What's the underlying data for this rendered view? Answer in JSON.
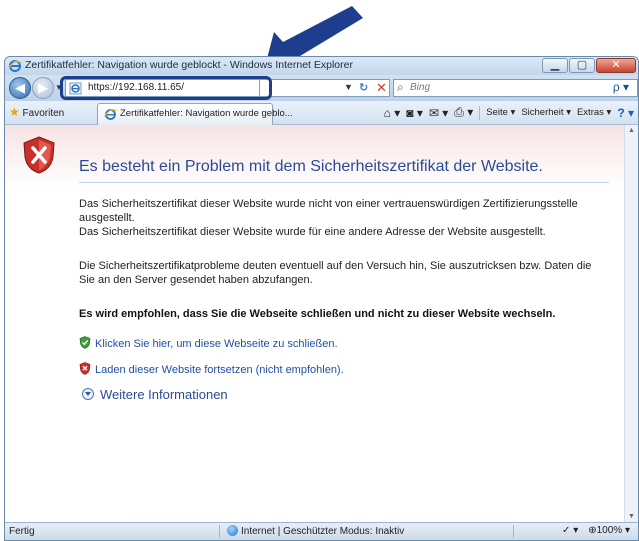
{
  "window": {
    "title": "Zertifikatfehler: Navigation wurde geblockt - Windows Internet Explorer",
    "minimize_symbol": "▁",
    "maximize_symbol": "▢",
    "close_symbol": "✕"
  },
  "nav": {
    "back_symbol": "◀",
    "forward_symbol": "▶",
    "dropdown_symbol": "▼",
    "address_url": "https://192.168.11.65/",
    "refresh_symbol": "↻",
    "stop_symbol": "✕",
    "search_placeholder": "Bing",
    "search_symbol": "⌕",
    "search_go_symbol": "ρ ▾"
  },
  "commandbar": {
    "favorites_label": "Favoriten",
    "tab_label": "Zertifikatfehler: Navigation wurde geblo...",
    "home_symbol": "⌂ ▾",
    "feeds_symbol": "◙ ▾",
    "mail_symbol": "✉ ▾",
    "print_symbol": "⎙ ▾",
    "page_label": "Seite ▾",
    "security_label": "Sicherheit ▾",
    "extras_label": "Extras ▾",
    "help_symbol": "? ▾"
  },
  "content": {
    "title": "Es besteht ein Problem mit dem Sicherheitszertifikat der Website.",
    "paragraph1_line1": "Das Sicherheitszertifikat dieser Website wurde nicht von einer vertrauenswürdigen Zertifizierungsstelle ausgestellt.",
    "paragraph1_line2": "Das Sicherheitszertifikat dieser Website wurde für eine andere Adresse der Website ausgestellt.",
    "paragraph2": "Die Sicherheitszertifikatprobleme deuten eventuell auf den Versuch hin, Sie auszutricksen bzw. Daten die Sie an den Server gesendet haben abzufangen.",
    "recommendation": "Es wird empfohlen, dass Sie die Webseite schließen und nicht zu dieser Website wechseln.",
    "link_close": "Klicken Sie hier, um diese Webseite zu schließen.",
    "link_continue": "Laden dieser Website fortsetzen (nicht empfohlen).",
    "more_info": "Weitere Informationen"
  },
  "statusbar": {
    "status": "Fertig",
    "zone": "Internet | Geschützter Modus: Inaktiv",
    "zoom_icon": "⊕",
    "zoom": "100%",
    "protect_symbol": "✓ ▾",
    "zoom_dropdown": "▾"
  },
  "colors": {
    "title_blue": "#2b4a96",
    "link_blue": "#1f4fa3",
    "annotation_arrow": "#1f3d8f",
    "error_red": "#c9302c"
  }
}
